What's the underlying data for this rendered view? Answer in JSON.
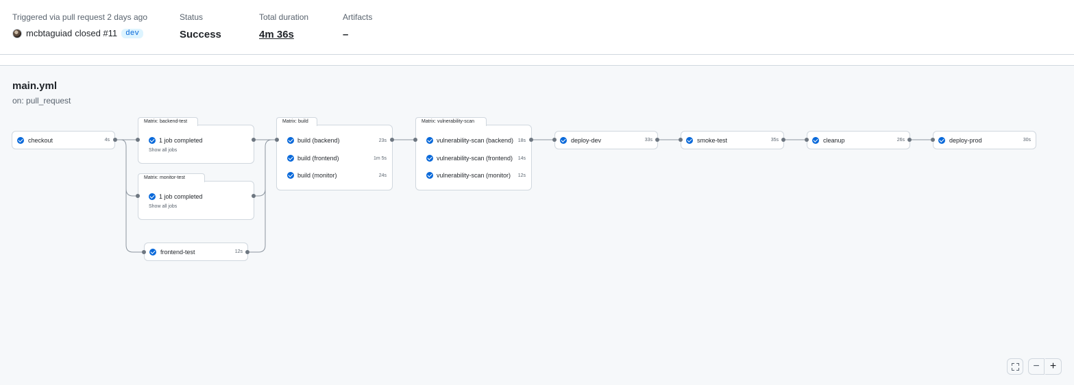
{
  "summary": {
    "trigger_label": "Triggered via pull request 2 days ago",
    "user": "mcbtaguiad",
    "action": "closed #11",
    "branch": "dev",
    "status_label": "Status",
    "status_value": "Success",
    "duration_label": "Total duration",
    "duration_value": "4m 36s",
    "artifacts_label": "Artifacts",
    "artifacts_value": "–"
  },
  "workflow": {
    "file": "main.yml",
    "trigger": "on: pull_request"
  },
  "jobs": {
    "checkout": {
      "name": "checkout",
      "duration": "4s",
      "status": "success"
    },
    "frontend_test": {
      "name": "frontend-test",
      "duration": "12s",
      "status": "success"
    },
    "deploy_dev": {
      "name": "deploy-dev",
      "duration": "33s",
      "status": "success"
    },
    "smoke_test": {
      "name": "smoke-test",
      "duration": "35s",
      "status": "success"
    },
    "cleanup": {
      "name": "cleanup",
      "duration": "26s",
      "status": "success"
    },
    "deploy_prod": {
      "name": "deploy-prod",
      "duration": "30s",
      "status": "success"
    }
  },
  "matrices": {
    "backend_test": {
      "label": "Matrix: backend-test",
      "summary": "1 job completed",
      "show_all": "Show all jobs"
    },
    "monitor_test": {
      "label": "Matrix: monitor-test",
      "summary": "1 job completed",
      "show_all": "Show all jobs"
    },
    "build": {
      "label": "Matrix: build",
      "jobs": [
        {
          "name": "build (backend)",
          "duration": "23s"
        },
        {
          "name": "build (frontend)",
          "duration": "1m 5s"
        },
        {
          "name": "build (monitor)",
          "duration": "24s"
        }
      ]
    },
    "vuln_scan": {
      "label": "Matrix: vulnerability-scan",
      "jobs": [
        {
          "name": "vulnerability-scan (backend)",
          "duration": "18s"
        },
        {
          "name": "vulnerability-scan (frontend)",
          "duration": "14s"
        },
        {
          "name": "vulnerability-scan (monitor)",
          "duration": "12s"
        }
      ]
    }
  },
  "controls": {
    "expand_icon": "fullscreen-icon",
    "zoom_out": "−",
    "zoom_in": "+"
  },
  "colors": {
    "success": "#0969da",
    "connector": "#8c959f",
    "dot": "#6e7781"
  }
}
